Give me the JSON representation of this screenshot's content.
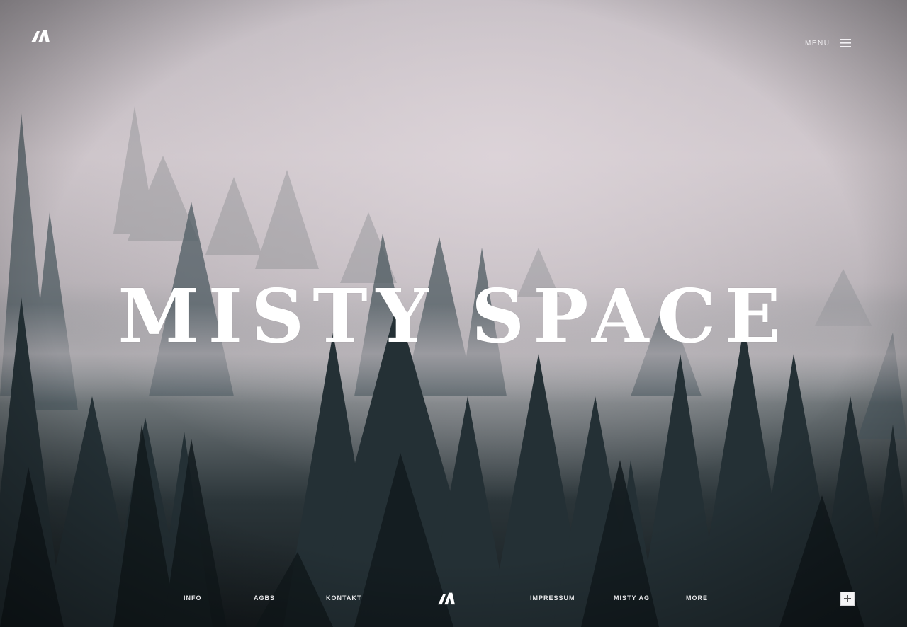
{
  "hero": {
    "title": "MISTY SPACE"
  },
  "header": {
    "logo_icon": "brand-logo-icon",
    "menu_label": "MENU",
    "menu_icon": "menu-icon"
  },
  "footer": {
    "links": [
      "INFO",
      "AGBS",
      "KONTAKT",
      "IMPRESSUM",
      "MISTY AG",
      "MORE"
    ],
    "logo_icon": "brand-logo-icon",
    "corner_button_icon": "plus-square-icon"
  },
  "colors": {
    "fog": "#c9c0c6",
    "forest_dark": "#1b2428",
    "text": "#ffffff"
  }
}
